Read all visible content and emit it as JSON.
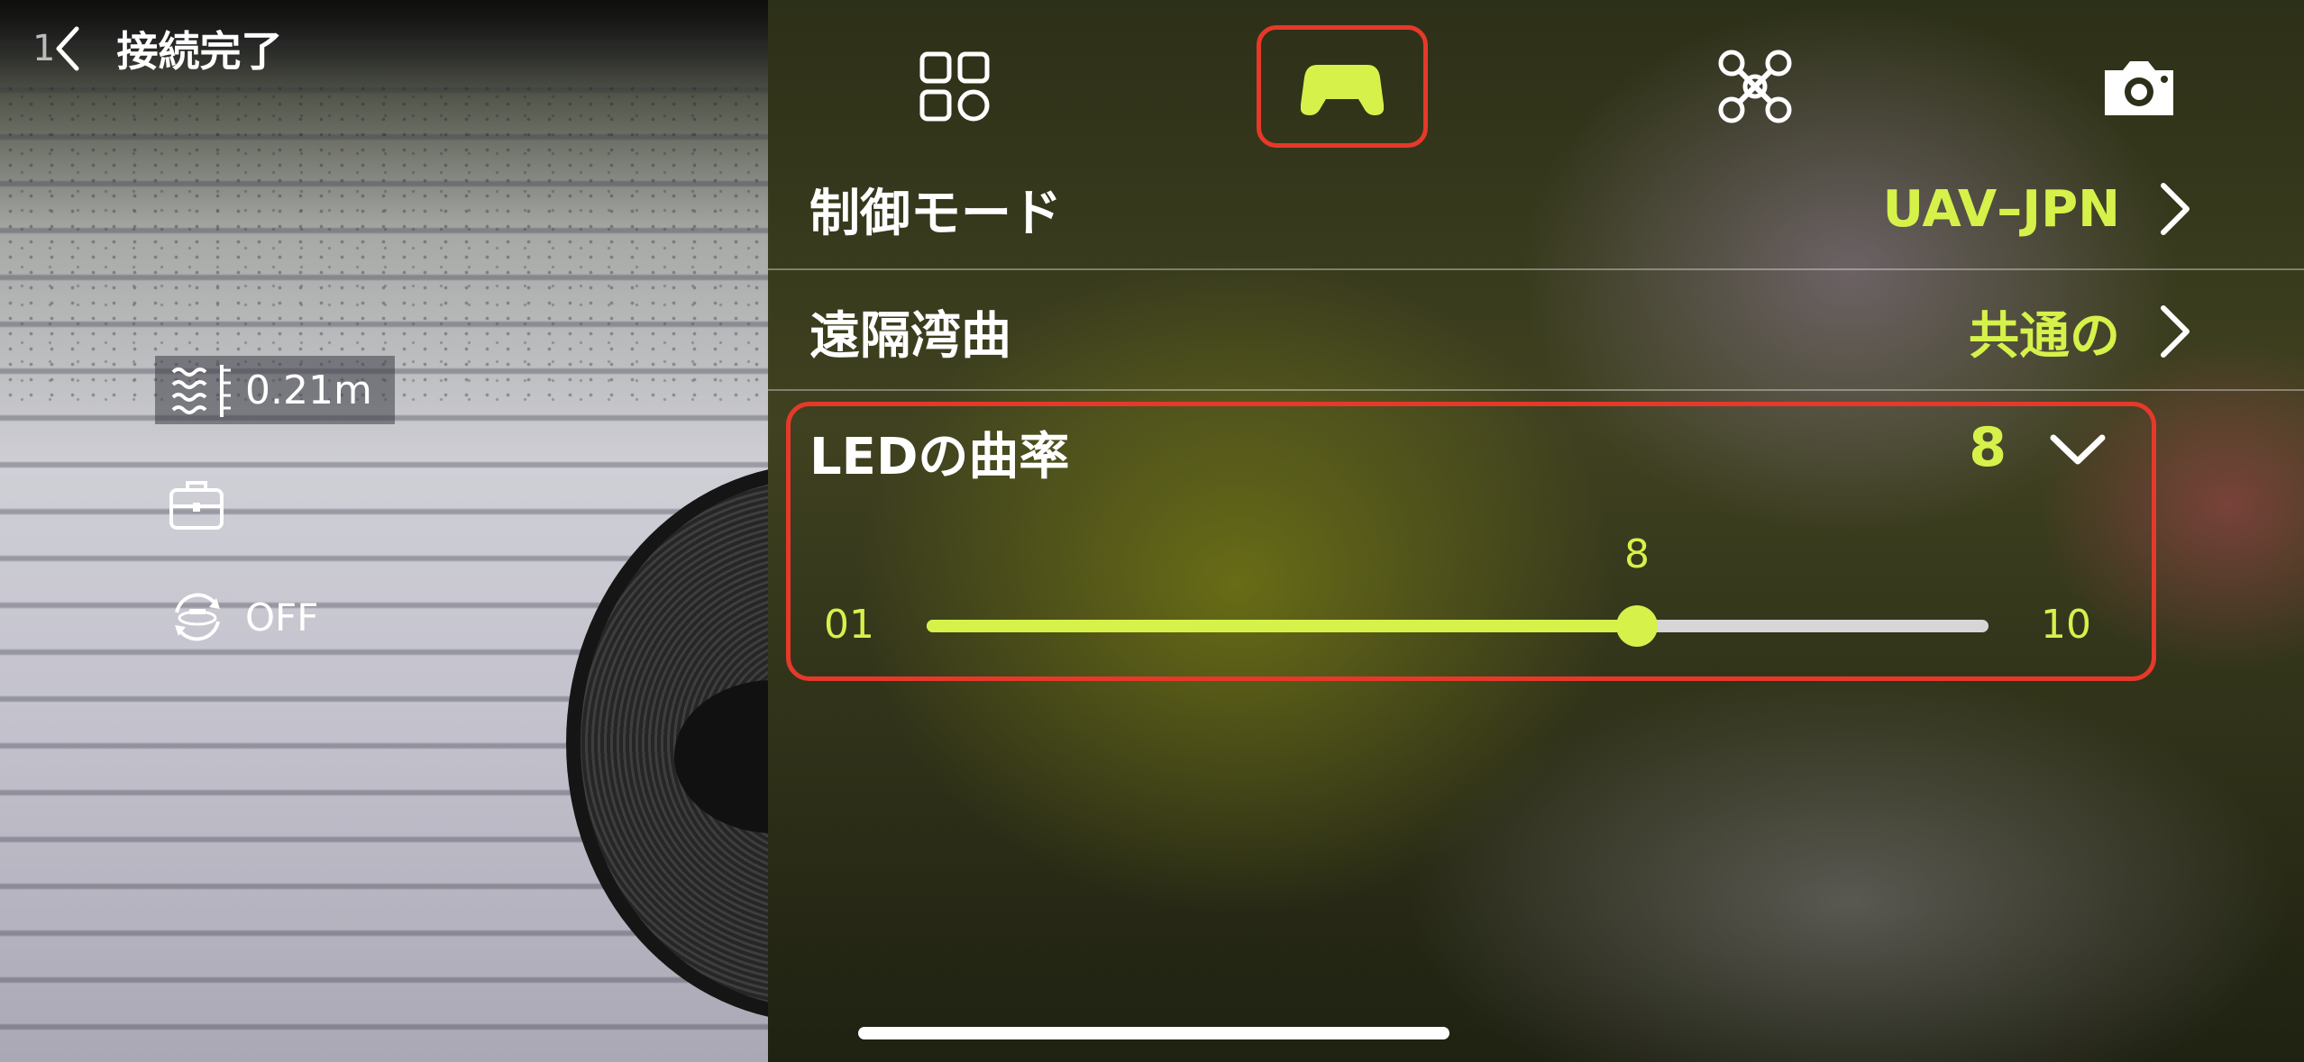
{
  "header": {
    "back_prefix": "1",
    "title": "接続完了"
  },
  "overlay": {
    "depth_value": "0.21m",
    "stabilizer_state": "OFF"
  },
  "tabs": [
    {
      "name": "overview",
      "icon": "grid-icon",
      "active": false
    },
    {
      "name": "controller",
      "icon": "gamepad-icon",
      "active": true
    },
    {
      "name": "drone",
      "icon": "drone-icon",
      "active": false
    },
    {
      "name": "camera",
      "icon": "camera-icon",
      "active": false
    }
  ],
  "settings": {
    "control_mode": {
      "label": "制御モード",
      "value": "UAV–JPN"
    },
    "remote_curve": {
      "label": "遠隔湾曲",
      "value": "共通の"
    },
    "led_curve": {
      "label": "LEDの曲率",
      "value": "8",
      "slider": {
        "min_label": "01",
        "max_label": "10",
        "min": 1,
        "max": 10,
        "current": 8,
        "current_label": "8"
      }
    }
  },
  "colors": {
    "accent": "#d6f24a",
    "highlight_border": "#e6392a",
    "text": "#ffffff"
  }
}
